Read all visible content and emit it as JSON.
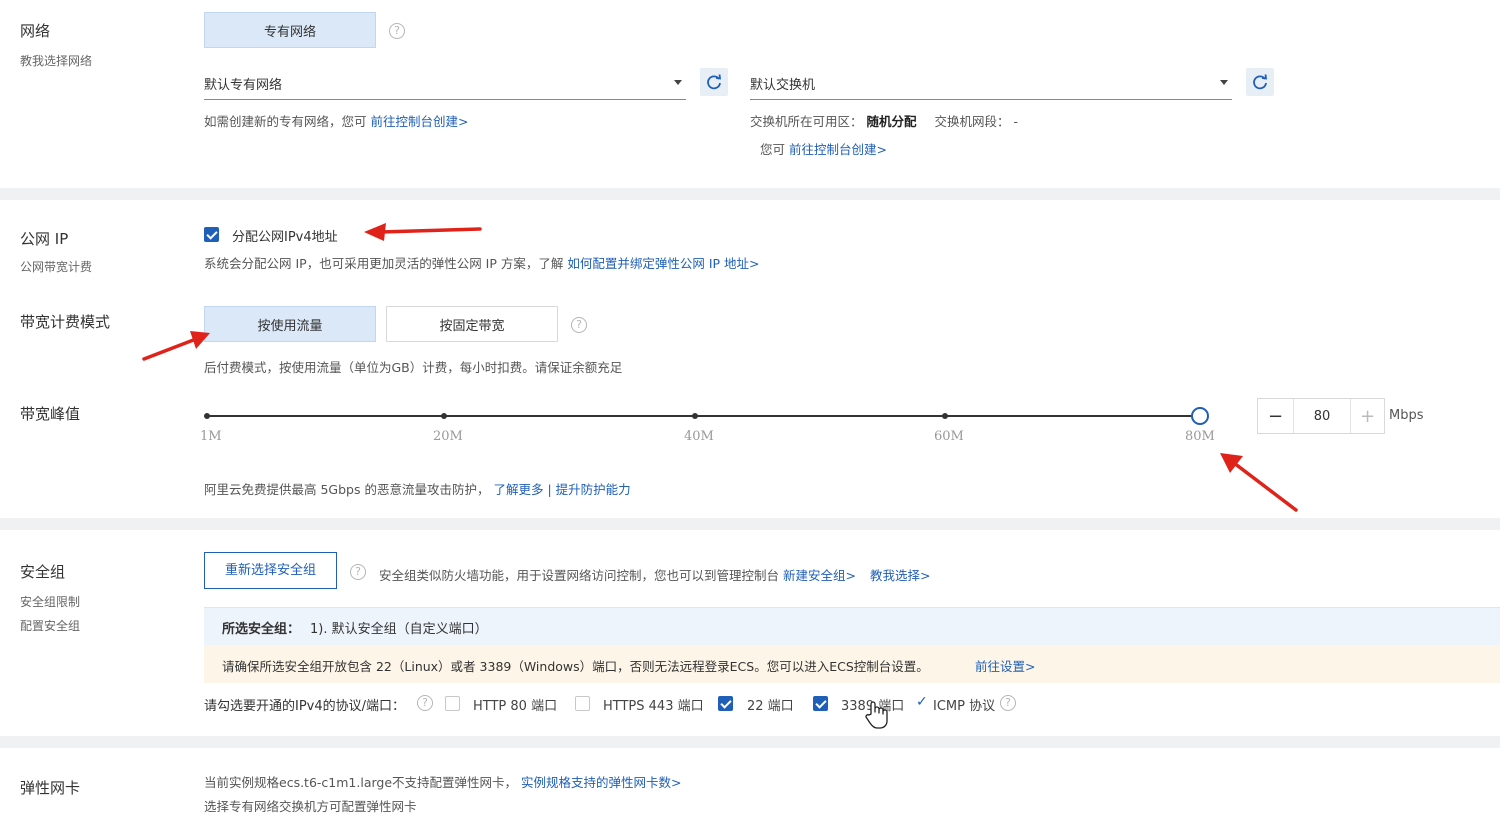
{
  "network": {
    "title": "网络",
    "subtitle": "教我选择网络",
    "type_tab": "专有网络",
    "vpc_select": "默认专有网络",
    "vswitch_select": "默认交换机",
    "vpc_hint_prefix": "如需创建新的专有网络，您可",
    "vpc_hint_link": "前往控制台创建>",
    "vswitch_zone_label": "交换机所在可用区：",
    "vswitch_zone_value": "随机分配",
    "vswitch_cidr_label": "交换机网段：",
    "vswitch_cidr_value": "-",
    "vswitch_hint_prefix": "您可",
    "vswitch_hint_link": "前往控制台创建>"
  },
  "public_ip": {
    "title": "公网 IP",
    "subtitle": "公网带宽计费",
    "assign_label": "分配公网IPv4地址",
    "assign_checked": true,
    "desc_prefix": "系统会分配公网 IP，也可采用更加灵活的弹性公网 IP 方案，了解",
    "desc_link": "如何配置并绑定弹性公网 IP 地址>"
  },
  "billing": {
    "title": "带宽计费模式",
    "tab_traffic": "按使用流量",
    "tab_fixed": "按固定带宽",
    "active_tab": "按使用流量",
    "desc": "后付费模式，按使用流量（单位为GB）计费，每小时扣费。请保证余额充足"
  },
  "bandwidth": {
    "title": "带宽峰值",
    "ticks": [
      "1M",
      "20M",
      "40M",
      "60M",
      "80M"
    ],
    "value": 80,
    "max": 80,
    "minus": "−",
    "plus": "+",
    "unit": "Mbps",
    "protect_prefix": "阿里云免费提供最高 5Gbps 的恶意流量攻击防护，",
    "protect_link1": "了解更多",
    "protect_sep": "|",
    "protect_link2": "提升防护能力"
  },
  "security_group": {
    "title": "安全组",
    "sub1": "安全组限制",
    "sub2": "配置安全组",
    "reselect_button": "重新选择安全组",
    "desc_prefix": "安全组类似防火墙功能，用于设置网络访问控制，您也可以到管理控制台",
    "desc_link1": "新建安全组>",
    "desc_link2": "教我选择>",
    "selected_label": "所选安全组：",
    "selected_value": "1). 默认安全组（自定义端口）",
    "warning_text": "请确保所选安全组开放包含 22（Linux）或者 3389（Windows）端口，否则无法远程登录ECS。您可以进入ECS控制台设置。",
    "warning_link": "前往设置>",
    "ports_label": "请勾选要开通的IPv4的协议/端口：",
    "ports": [
      {
        "label": "HTTP 80 端口",
        "checked": false
      },
      {
        "label": "HTTPS 443 端口",
        "checked": false
      },
      {
        "label": "22 端口",
        "checked": true
      },
      {
        "label": "3389 端口",
        "checked": true
      }
    ],
    "icmp_mark": "✓",
    "icmp_label": "ICMP 协议"
  },
  "eni": {
    "title": "弹性网卡",
    "line1_prefix": "当前实例规格ecs.t6-c1m1.large不支持配置弹性网卡，",
    "line1_link": "实例规格支持的弹性网卡数>",
    "line2": "选择专有网络交换机方可配置弹性网卡"
  },
  "colors": {
    "accent": "#1f5fb8",
    "annotation_arrow": "#e0231a",
    "warning_bg": "#fdf6e8",
    "selected_bg": "#eef4fc"
  },
  "icons": {
    "help": "?",
    "refresh": "refresh-icon",
    "cursor": "hand-pointer-icon"
  }
}
